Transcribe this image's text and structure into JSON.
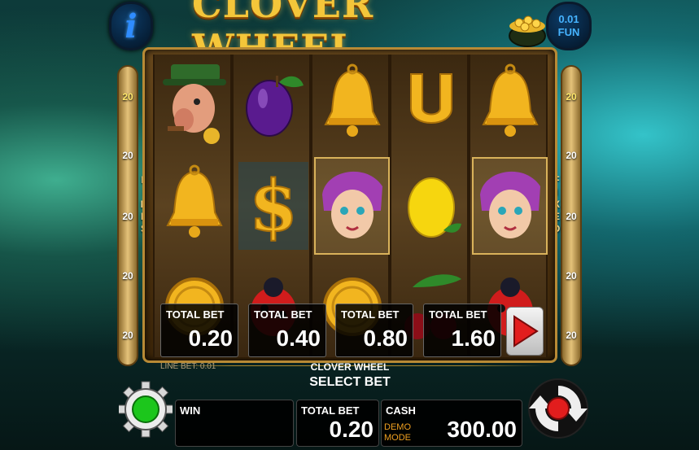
{
  "header": {
    "info_icon": "info-icon",
    "info_glyph": "i",
    "logo_text": "CLOVER WHEEL",
    "denomination_value": "0.01",
    "denomination_currency": "FUN"
  },
  "paylines": {
    "left_numbers": [
      "20",
      "20",
      "20",
      "20",
      "20"
    ],
    "right_numbers": [
      "20",
      "20",
      "20",
      "20",
      "20"
    ],
    "left_label": [
      "L",
      "I",
      "N",
      "E",
      "S"
    ],
    "right_label": [
      "F",
      "I",
      "X",
      "E",
      "D"
    ]
  },
  "reels": [
    [
      "leprechaun",
      "bell",
      "gold-coin"
    ],
    [
      "plum",
      "dollar-sign",
      "ladybug"
    ],
    [
      "bell",
      "fairy",
      "gold-coin"
    ],
    [
      "horseshoe",
      "lemon",
      "cherries"
    ],
    [
      "bell",
      "fairy",
      "ladybug"
    ]
  ],
  "bet_options": [
    {
      "label": "TOTAL BET",
      "value": "0.20"
    },
    {
      "label": "TOTAL BET",
      "value": "0.40"
    },
    {
      "label": "TOTAL BET",
      "value": "0.80"
    },
    {
      "label": "TOTAL BET",
      "value": "1.60"
    }
  ],
  "info": {
    "line_bet": "LINE BET: 0.01",
    "game_name": "CLOVER WHEEL",
    "select_bet": "SELECT BET"
  },
  "bottom": {
    "win_label": "WIN",
    "win_value": "",
    "total_bet_label": "TOTAL BET",
    "total_bet_value": "0.20",
    "cash_label": "CASH",
    "demo_line1": "DEMO",
    "demo_line2": "MODE",
    "cash_value": "300.00"
  },
  "colors": {
    "logo_gold": "#f4c63a",
    "play_arrow": "#e21d1d",
    "settings_green": "#1cc61c",
    "autospin_red": "#e21d1d",
    "denom_blue": "#46b3ff"
  }
}
